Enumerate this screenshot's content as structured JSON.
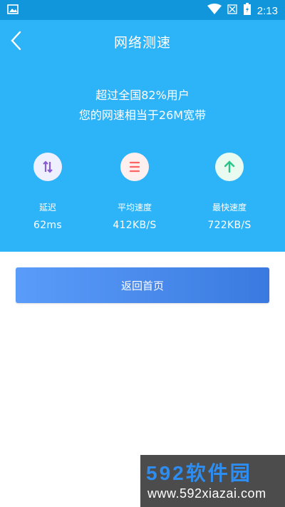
{
  "status_bar": {
    "time": "2:13",
    "icons": [
      "image-icon",
      "wifi-icon",
      "no-signal-icon",
      "battery-icon"
    ]
  },
  "header": {
    "title": "网络测速",
    "summary_line1": "超过全国82%用户",
    "summary_line2": "您的网速相当于26M宽带",
    "background_color": "#2db3f7"
  },
  "stats": [
    {
      "label": "延迟",
      "value": "62ms",
      "icon": "latency-icon",
      "color": "#8a5cd4",
      "circle": "#eef0ff"
    },
    {
      "label": "平均速度",
      "value": "412KB/S",
      "icon": "average-speed-icon",
      "color": "#ff6464",
      "circle": "#ffefef"
    },
    {
      "label": "最快速度",
      "value": "722KB/S",
      "icon": "arrow-up-icon",
      "color": "#28c486",
      "circle": "#e9fbf1"
    }
  ],
  "button": {
    "label": "返回首页"
  },
  "watermark": {
    "brand": "592软件园",
    "url": "www.592xiazai.com"
  }
}
